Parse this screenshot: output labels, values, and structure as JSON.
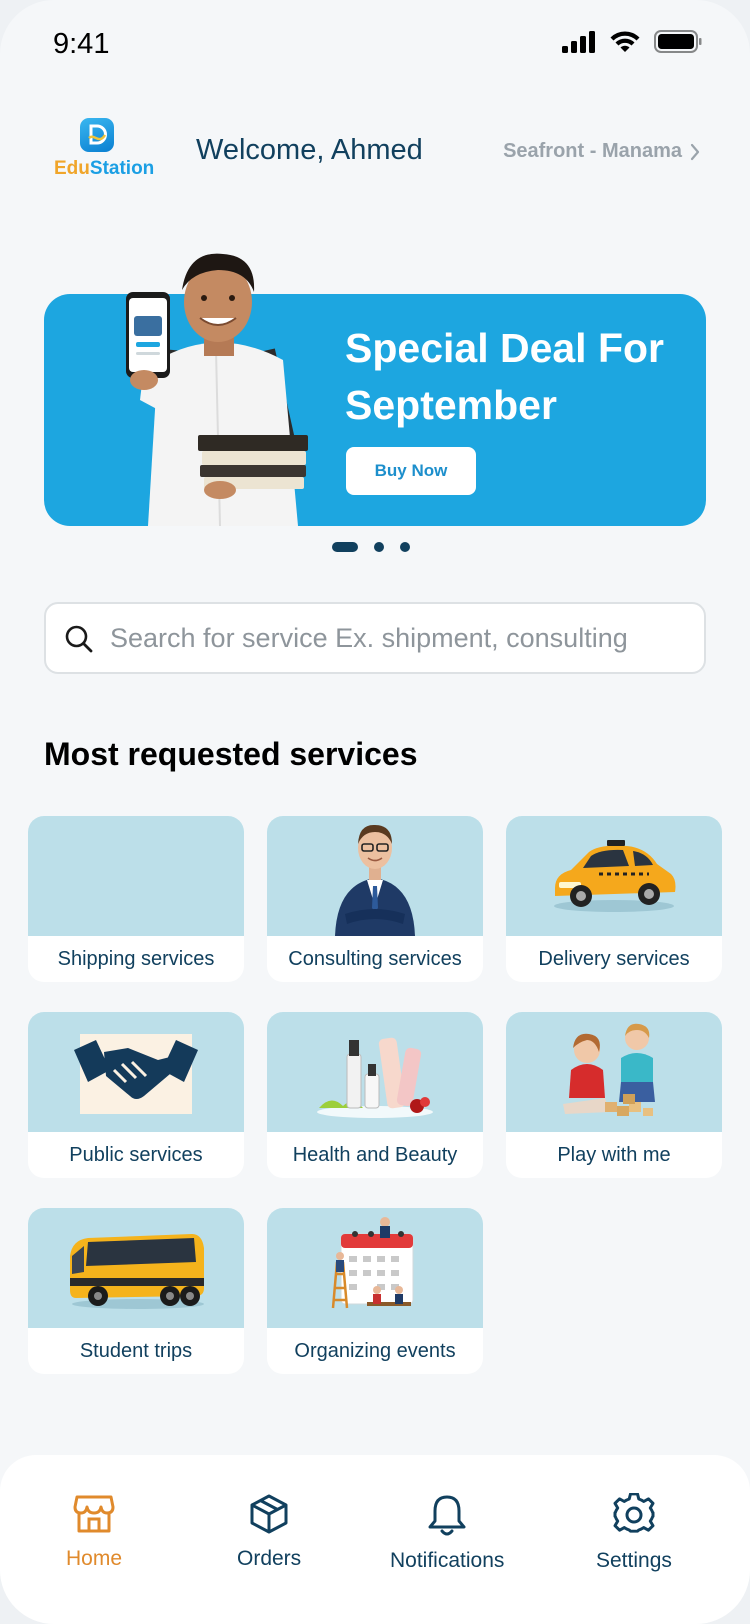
{
  "status": {
    "time": "9:41"
  },
  "header": {
    "logo": {
      "part1": "Edu",
      "part2": "Station"
    },
    "welcome": "Welcome, Ahmed",
    "location": "Seafront - Manama"
  },
  "banner": {
    "title": "Special Deal For September",
    "button": "Buy Now",
    "slides": 3,
    "active_slide": 1
  },
  "search": {
    "placeholder": "Search for service Ex. shipment, consulting",
    "value": ""
  },
  "section": {
    "title": "Most requested services"
  },
  "services": [
    {
      "label": "Shipping services",
      "icon": "shipping-image"
    },
    {
      "label": "Consulting services",
      "icon": "consultant-image"
    },
    {
      "label": "Delivery services",
      "icon": "taxi-car-image"
    },
    {
      "label": "Public services",
      "icon": "handshake-image"
    },
    {
      "label": "Health and Beauty",
      "icon": "cosmetics-image"
    },
    {
      "label": "Play with me",
      "icon": "kids-playing-image"
    },
    {
      "label": "Student trips",
      "icon": "bus-image"
    },
    {
      "label": "Organizing events",
      "icon": "calendar-event-image"
    }
  ],
  "nav": [
    {
      "label": "Home",
      "icon": "home-icon",
      "active": true
    },
    {
      "label": "Orders",
      "icon": "box-icon",
      "active": false
    },
    {
      "label": "Notifications",
      "icon": "bell-icon",
      "active": false
    },
    {
      "label": "Settings",
      "icon": "gear-icon",
      "active": false
    }
  ],
  "colors": {
    "primary": "#11405e",
    "banner": "#1da6e0",
    "accent": "#e08a2c",
    "card_image_bg": "#bcdfe9"
  }
}
